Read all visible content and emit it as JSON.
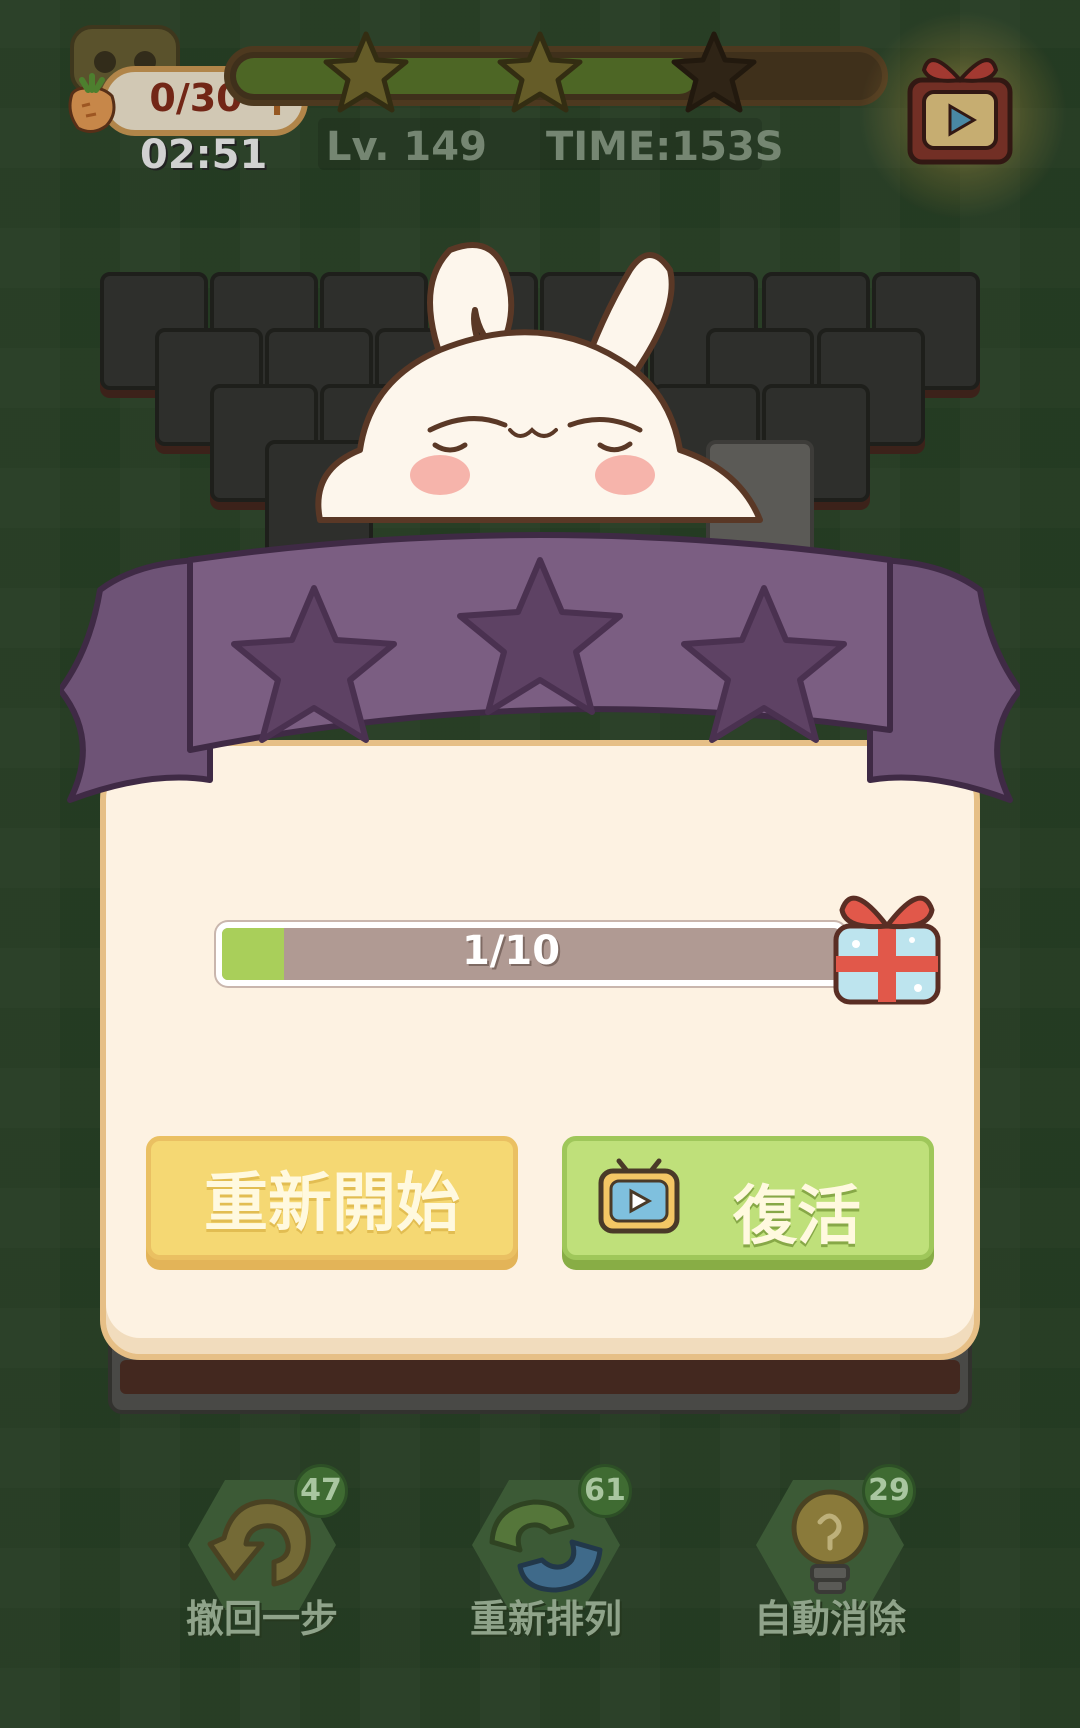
{
  "hud": {
    "carrots": "0/30",
    "carrot_plus": "+",
    "clock": "02:51",
    "level": "Lv. 149",
    "time": "TIME:153S",
    "star_progress": 0.72,
    "stars_earned": 2,
    "stars_total": 3
  },
  "popup": {
    "stars_earned": 0,
    "stars_total": 3,
    "progress_text": "1/10",
    "progress_value": 0.1,
    "restart_label": "重新開始",
    "revive_label": "復活"
  },
  "tools": [
    {
      "label": "撤回一步",
      "count": "47",
      "icon": "undo-icon"
    },
    {
      "label": "重新排列",
      "count": "61",
      "icon": "shuffle-icon"
    },
    {
      "label": "自動消除",
      "count": "29",
      "icon": "lightbulb-icon"
    }
  ],
  "colors": {
    "background": "#2f4a2c",
    "ribbon": "#7b5e82",
    "restart_button": "#f5d873",
    "revive_button": "#bfe07a"
  }
}
